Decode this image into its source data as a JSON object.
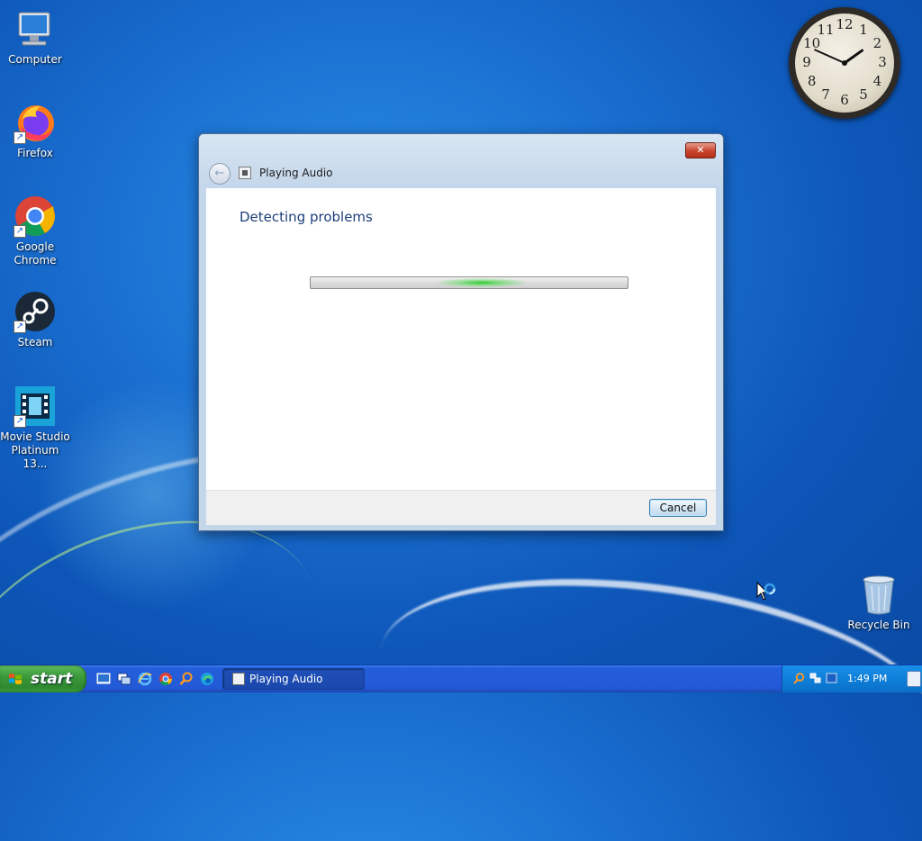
{
  "desktop": {
    "icons": [
      {
        "label": "Computer"
      },
      {
        "label": "Firefox"
      },
      {
        "label": "Google Chrome"
      },
      {
        "label": "Steam"
      },
      {
        "label": "Movie Studio Platinum 13..."
      }
    ],
    "recycle_bin": {
      "label": "Recycle Bin"
    }
  },
  "clock_gadget": {
    "numerals": [
      "12",
      "1",
      "2",
      "3",
      "4",
      "5",
      "6",
      "7",
      "8",
      "9",
      "10",
      "11"
    ],
    "hour": 1,
    "minute": 49
  },
  "dialog": {
    "title": "Playing Audio",
    "close_label": "✕",
    "back_label": "←",
    "heading": "Detecting problems",
    "cancel_label": "Cancel",
    "progress_state": "indeterminate"
  },
  "taskbar": {
    "start_label": "start",
    "quick_launch": [
      "show-desktop-icon",
      "window-switch-icon",
      "internet-explorer-icon",
      "chrome-icon",
      "search-icon",
      "edge-icon"
    ],
    "active_task": {
      "label": "Playing Audio"
    },
    "tray": {
      "time": "1:49 PM"
    }
  },
  "colors": {
    "desktop_blue": "#1a6fd0",
    "taskbar_blue": "#245edb",
    "start_green": "#3c9a3b",
    "heading_blue": "#1e3f7a",
    "progress_green": "#28c828"
  }
}
